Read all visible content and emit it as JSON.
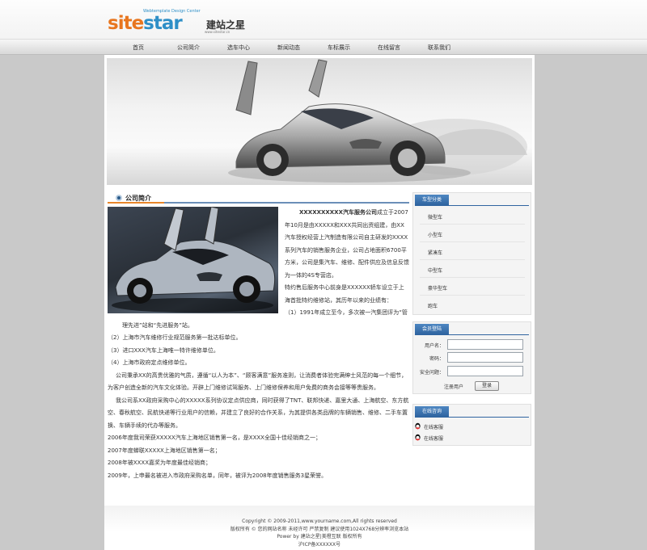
{
  "logo": {
    "word_a": "site",
    "word_b": "star",
    "cn": "建站之星",
    "sub": "Webtemplate Design Center",
    "url": "www.sitestar.cn"
  },
  "nav": {
    "items": [
      {
        "label": "首页"
      },
      {
        "label": "公司简介"
      },
      {
        "label": "选车中心"
      },
      {
        "label": "新闻动态"
      },
      {
        "label": "车标展示"
      },
      {
        "label": "在线留言"
      },
      {
        "label": "联系我们"
      }
    ]
  },
  "main": {
    "title": "公司简介",
    "article": {
      "company": "XXXXXXXXXX汽车服务公司",
      "lead": "成立于2007年10月是由XXXXX和XXX共同出资组建，由XX汽车授权经营上汽制造有限公司自主研发的XXXX系列汽车的销售服务企业，公司占地面积6700平方米，公司是集汽车、维修、配件供应及信息反馈为一体的4S专营店。",
      "p2": "特约售后服务中心前身是XXXXXX轿车设立于上海首批特约维修站，其历年以来的业绩有：",
      "p3": "（1）1991年成立至今，多次被一汽集团评为“管理先进”站和“先进服务”站。",
      "p4": "（2）上海市汽车维修行业规范服务第一批达标单位。",
      "p5": "（3）进口XXX汽车上海唯一特许维修单位。",
      "p6": "（4）上海市政府定点维修单位。",
      "p7": "公司秉承XX的高贵优雅的气质，遵循“以人为本”、“顾客满意”服务准则，让消费者体验完满绅士风范的每一个细节，为客户创造全新的汽车文化体验。开辟上门维修试驾服务、上门维修保养和用户免费的商务会接等等贵服务。",
      "p8": "我公司系XX政府采购中心的XXXXX系列协议定点供应商，同时获得了TNT、联邦快递、嘉里大通、上海航空、东方航空、春秋航空、民航快递等行业用户的信赖，并建立了良好的合作关系，为其提供各类品牌的车辆销售、维修、二手车置换、车辆手续的代办等服务。",
      "p9": "2006年度我司荣获XXXXX汽车上海地区销售第一名，是XXXX全国十佳经销商之一；",
      "p10": "2007年度蝉联XXXXX上海地区销售第一名；",
      "p11": "2008年被XXXX嘉奖为年度最佳经销商；",
      "p12": "2009年，上申最名被进入市政府采购名单，同年，被评为2008年度销售服务3星荣誉。"
    }
  },
  "sidebar": {
    "categories": {
      "title": "车型分类",
      "items": [
        {
          "label": "微型车"
        },
        {
          "label": "小型车"
        },
        {
          "label": "紧凑车"
        },
        {
          "label": "中型车"
        },
        {
          "label": "豪华型车"
        },
        {
          "label": "跑车"
        }
      ]
    },
    "login": {
      "title": "会员登陆",
      "username_label": "用户名：",
      "password_label": "密码：",
      "security_label": "安全问题：",
      "register_label": "注册用户",
      "login_label": "登录"
    },
    "service": {
      "title": "在线咨询",
      "items": [
        {
          "label": "在线客服"
        },
        {
          "label": "在线客服"
        }
      ]
    }
  },
  "footer": {
    "line1": "Copyright © 2009-2011,www.yourname.com,All rights reserved",
    "line2": "版权所有 © 您的网站名称 未经许可  严禁复制 建议使用1024X768分辨率浏览本站",
    "line3": "Power by 建站之星|美橙互联 版权所有",
    "line4": "沪ICP备XXXXXX号"
  },
  "colors": {
    "accent_blue": "#2f64a0",
    "accent_orange": "#e8862a",
    "logo_orange": "#e8761f",
    "logo_blue": "#2e8fc7"
  }
}
